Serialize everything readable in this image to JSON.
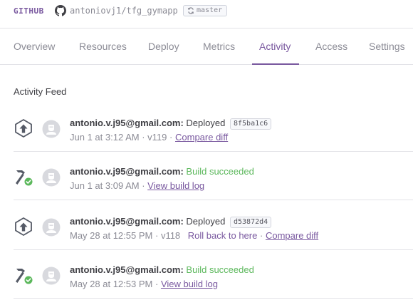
{
  "header": {
    "brand": "GITHUB",
    "repo": "antoniovj1/tfg_gymapp",
    "branch": "master"
  },
  "tabs": [
    {
      "label": "Overview",
      "active": false
    },
    {
      "label": "Resources",
      "active": false
    },
    {
      "label": "Deploy",
      "active": false
    },
    {
      "label": "Metrics",
      "active": false
    },
    {
      "label": "Activity",
      "active": true
    },
    {
      "label": "Access",
      "active": false
    },
    {
      "label": "Settings",
      "active": false
    }
  ],
  "feed": {
    "title": "Activity Feed",
    "items": [
      {
        "type": "deploy",
        "email": "antonio.v.j95@gmail.com:",
        "action": "Deployed",
        "hash": "8f5ba1c6",
        "time": "Jun 1 at 3:12 AM",
        "version": "v119",
        "link": "Compare diff"
      },
      {
        "type": "build",
        "email": "antonio.v.j95@gmail.com:",
        "action": "Build succeeded",
        "time": "Jun 1 at 3:09 AM",
        "link": "View build log"
      },
      {
        "type": "deploy",
        "email": "antonio.v.j95@gmail.com:",
        "action": "Deployed",
        "hash": "d53872d4",
        "time": "May 28 at 12:55 PM",
        "version": "v118",
        "rollback": "Roll back to here",
        "link": "Compare diff"
      },
      {
        "type": "build",
        "email": "antonio.v.j95@gmail.com:",
        "action": "Build succeeded",
        "time": "May 28 at 12:53 PM",
        "link": "View build log"
      }
    ]
  },
  "colors": {
    "accent": "#79589f",
    "success": "#5cb85c",
    "muted": "#8b8b95",
    "text": "#3f3f44"
  }
}
